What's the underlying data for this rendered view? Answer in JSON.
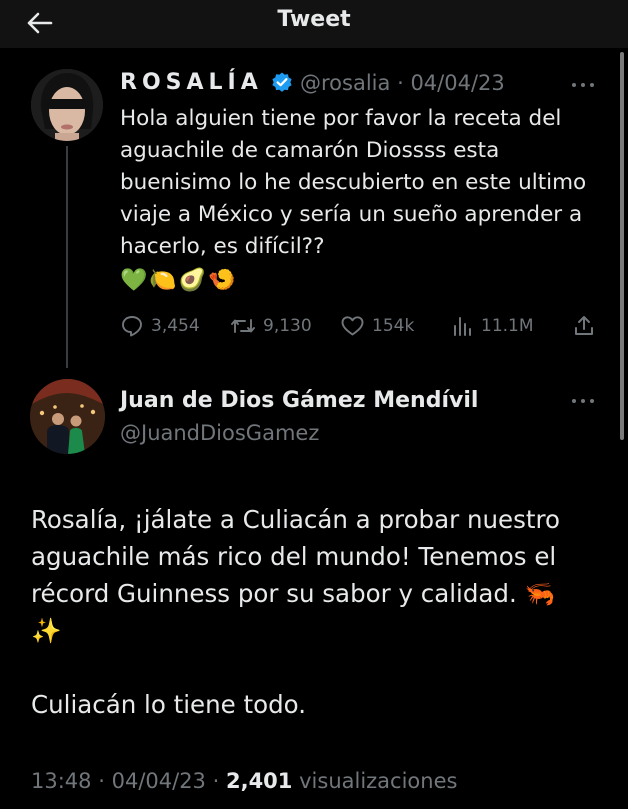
{
  "header": {
    "title": "Tweet"
  },
  "reply_to": {
    "display_name": "ROSALÍA",
    "handle": "@rosalia",
    "separator": "·",
    "date": "04/04/23",
    "text": "Hola alguien tiene por favor la receta del aguachile de camarón Diossss esta buenisimo lo he descubierto en este ultimo viaje a México y sería un sueño aprender a hacerlo, es difícil??",
    "emojis": "💚🍋🥑🍤",
    "stats": {
      "replies": "3,454",
      "retweets": "9,130",
      "likes": "154k",
      "views": "11.1M"
    }
  },
  "tweet": {
    "display_name": "Juan de Dios Gámez Mendívil",
    "handle": "@JuandDiosGamez",
    "text": "Rosalía, ¡jálate a Culiacán a probar nuestro aguachile más rico del mundo! Tenemos el récord Guinness por su sabor y calidad. 🦐\n✨\n\nCuliacán lo tiene todo.",
    "time": "13:48",
    "separator": "·",
    "date": "04/04/23",
    "views_count": "2,401",
    "views_label": "visualizaciones"
  },
  "colors": {
    "background": "#000000",
    "text": "#e7e9ea",
    "muted": "#71767b",
    "verified": "#1d9bf0"
  }
}
